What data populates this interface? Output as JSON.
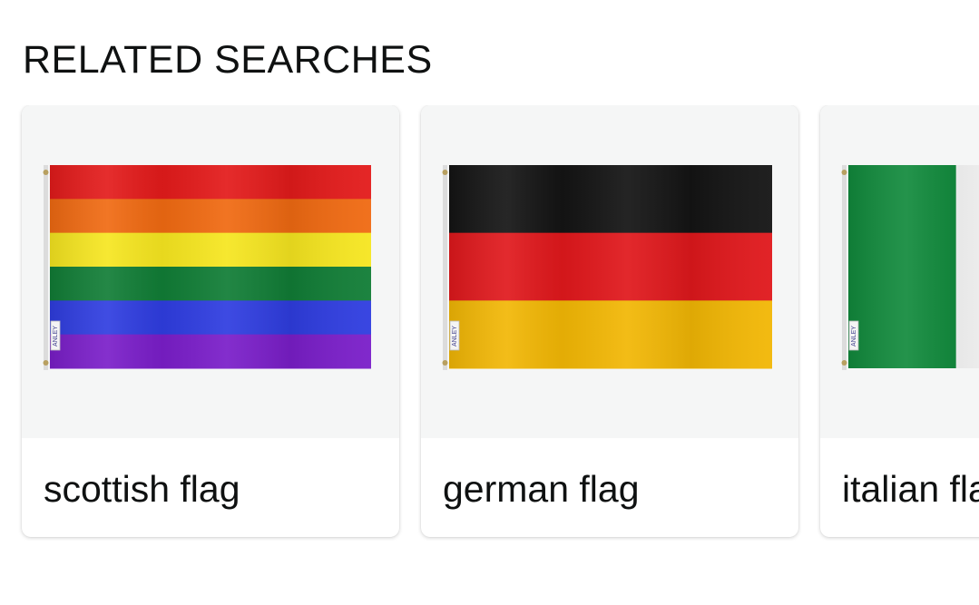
{
  "section": {
    "title": "RELATED SEARCHES"
  },
  "cards": [
    {
      "label": "scottish flag",
      "flag": "rainbow-flag",
      "tag_text": "ANLEY",
      "stripe_colors": [
        "#e31b1b",
        "#f06a12",
        "#f6e620",
        "#117d36",
        "#2f3de0",
        "#7a1ec9"
      ]
    },
    {
      "label": "german flag",
      "flag": "german-flag",
      "tag_text": "ANLEY",
      "stripe_colors": [
        "#141414",
        "#e0181c",
        "#f2b705"
      ]
    },
    {
      "label": "italian flag",
      "flag": "italian-flag",
      "tag_text": "ANLEY",
      "stripe_colors": [
        "#118a3c",
        "#f7f7f7",
        "#d0202b"
      ]
    }
  ]
}
